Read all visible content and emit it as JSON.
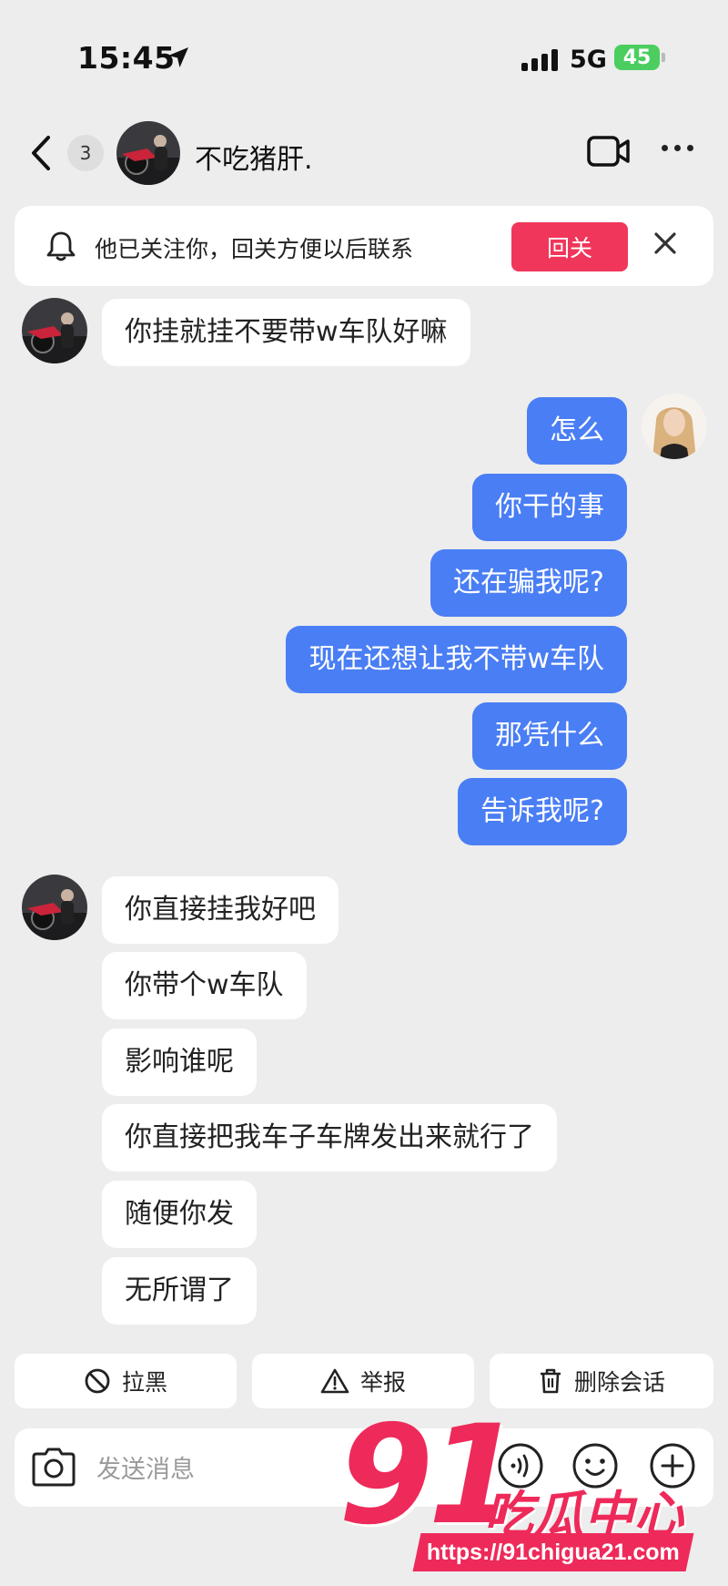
{
  "status_bar": {
    "time": "15:45",
    "network": "5G",
    "battery": "45"
  },
  "header": {
    "unread_count": "3",
    "contact_name": "不吃猪肝."
  },
  "banner": {
    "text": "他已关注你，回关方便以后联系",
    "follow_back_label": "回关"
  },
  "messages": [
    {
      "side": "in",
      "text": "你挂就挂不要带w车队好嘛"
    },
    {
      "side": "out",
      "text": "怎么"
    },
    {
      "side": "out",
      "text": "你干的事"
    },
    {
      "side": "out",
      "text": "还在骗我呢?"
    },
    {
      "side": "out",
      "text": "现在还想让我不带w车队"
    },
    {
      "side": "out",
      "text": "那凭什么"
    },
    {
      "side": "out",
      "text": "告诉我呢?"
    },
    {
      "side": "in",
      "text": "你直接挂我好吧"
    },
    {
      "side": "in",
      "text": "你带个w车队"
    },
    {
      "side": "in",
      "text": "影响谁呢"
    },
    {
      "side": "in",
      "text": "你直接把我车子车牌发出来就行了"
    },
    {
      "side": "in",
      "text": "随便你发"
    },
    {
      "side": "in",
      "text": "无所谓了"
    }
  ],
  "actions": {
    "block_label": "拉黑",
    "report_label": "举报",
    "delete_label": "删除会话"
  },
  "input": {
    "placeholder": "发送消息"
  },
  "watermark": {
    "number": "91",
    "title": "吃瓜中心",
    "url": "https://91chigua21.com"
  },
  "colors": {
    "accent_pink": "#f0365a",
    "outgoing_bubble": "#4a7ef4",
    "battery_green": "#4ccd5f"
  }
}
